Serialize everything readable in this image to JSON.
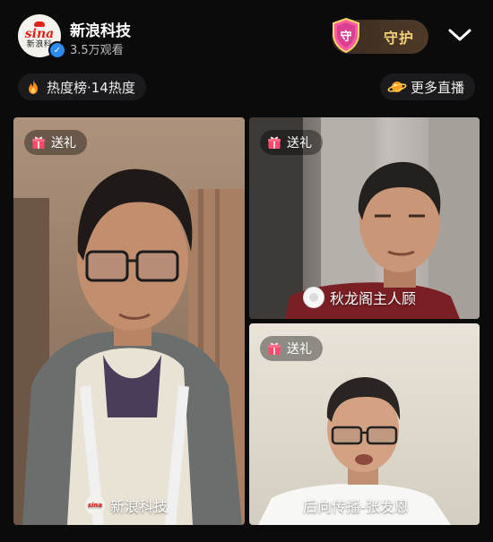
{
  "header": {
    "channel_name": "新浪科技",
    "viewers": "3.5万观看",
    "guard_label": "守护",
    "guard_shield_char": "守",
    "avatar_text_top": "sina",
    "avatar_text_bottom": "新浪科"
  },
  "subheader": {
    "heat_label": "热度榜·14热度",
    "more_live_label": "更多直播"
  },
  "tiles": [
    {
      "gift_label": "送礼",
      "host_name": "新浪科技",
      "avatar_text": "sina"
    },
    {
      "gift_label": "送礼",
      "host_name": "秋龙阁主人顾"
    },
    {
      "gift_label": "送礼",
      "host_name": "后向传播-张发恩"
    }
  ],
  "colors": {
    "background": "#0b0b0c",
    "brand_red": "#e2231a",
    "guard_gold": "#f2d17a",
    "verified_blue": "#2a8bf2"
  },
  "icons": [
    "verified-icon",
    "shield-icon",
    "chevron-down-icon",
    "flame-icon",
    "planet-icon",
    "gift-icon"
  ]
}
